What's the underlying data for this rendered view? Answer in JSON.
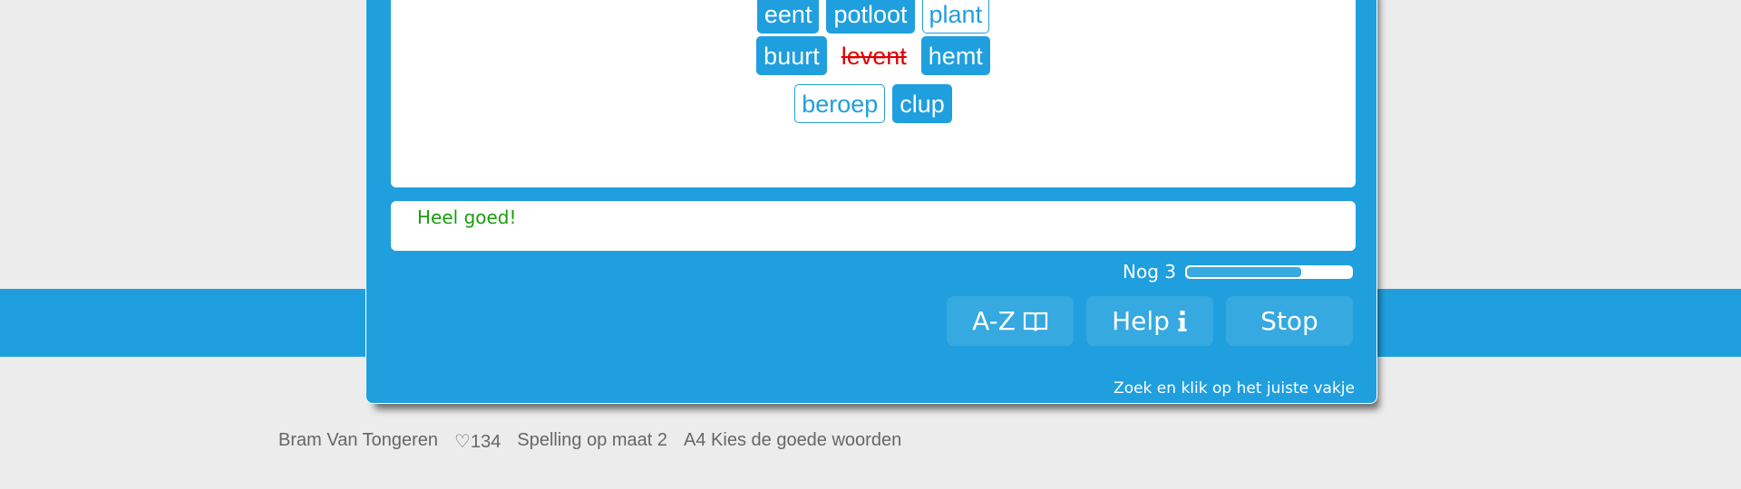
{
  "words": {
    "rows": [
      [
        {
          "text": "eent",
          "state": "solid"
        },
        {
          "text": "potloot",
          "state": "solid"
        },
        {
          "text": "plant",
          "state": "outline"
        }
      ],
      [
        {
          "text": "buurt",
          "state": "solid"
        },
        {
          "text": "levent",
          "state": "wrong"
        },
        {
          "text": "hemt",
          "state": "solid"
        }
      ],
      [
        {
          "text": "beroep",
          "state": "outline"
        },
        {
          "text": "clup",
          "state": "solid"
        }
      ]
    ]
  },
  "feedback": {
    "text": "Heel goed!"
  },
  "progress": {
    "label": "Nog 3",
    "fraction": 0.7
  },
  "buttons": {
    "az_label": "A-Z",
    "az_icon": "book-icon",
    "help_label": "Help",
    "help_icon": "info-icon",
    "stop_label": "Stop"
  },
  "hint": "Zoek en klik op het juiste vakje",
  "footer": {
    "user": "Bram Van Tongeren",
    "likes": "♡134",
    "course": "Spelling op maat 2",
    "exercise": "A4 Kies de goede woorden"
  },
  "colors": {
    "accent": "#209fdf",
    "button": "#35a9e0",
    "correct": "#1a9c10",
    "wrong": "#e00000",
    "background": "#ececec"
  }
}
